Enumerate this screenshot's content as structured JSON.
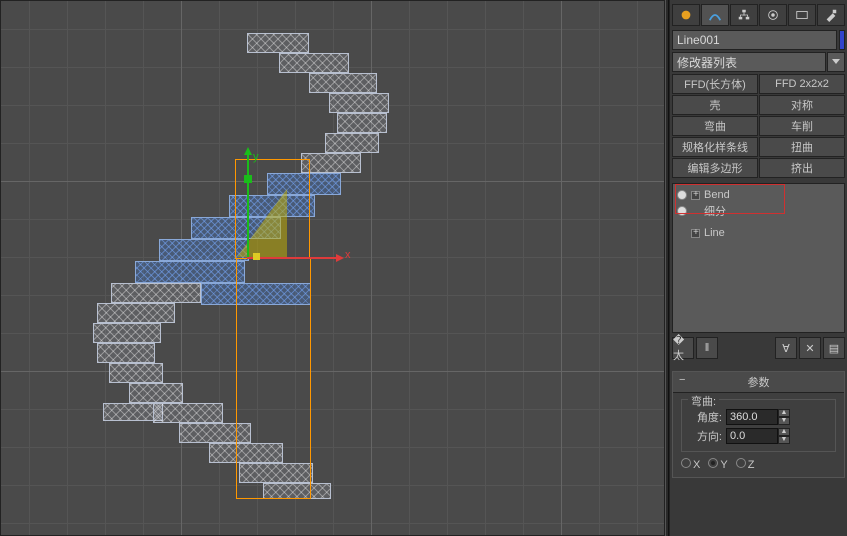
{
  "object_name": "Line001",
  "modifier_dropdown": "修改器列表",
  "mod_buttons": [
    "FFD(长方体)",
    "FFD 2x2x2",
    "壳",
    "对称",
    "弯曲",
    "车削",
    "规格化样条线",
    "扭曲",
    "编辑多边形",
    "挤出"
  ],
  "stack": [
    {
      "label": "Bend",
      "has_bulb": true,
      "has_plus": true
    },
    {
      "label": "细分",
      "has_bulb": true,
      "has_plus": false
    },
    {
      "label": "Line",
      "has_bulb": false,
      "has_plus": true
    }
  ],
  "rollout_title": "参数",
  "bend_group": "弯曲:",
  "angle_label": "角度:",
  "angle_value": "360.0",
  "dir_label": "方向:",
  "dir_value": "0.0",
  "axis_labels": [
    "X",
    "Y",
    "Z"
  ],
  "axis_selected": 1,
  "gizmo": {
    "x": "x",
    "y": "y"
  }
}
